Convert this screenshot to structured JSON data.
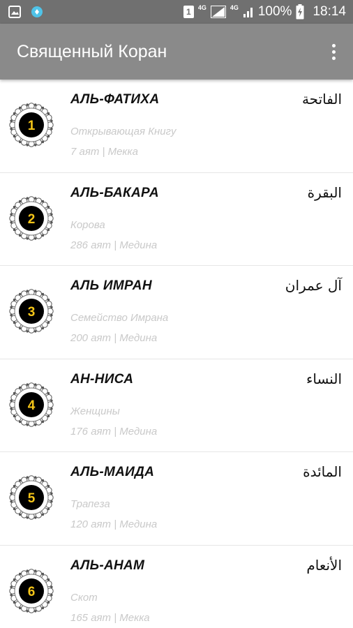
{
  "status_bar": {
    "icons_left": [
      "gallery-icon",
      "app-notification-icon"
    ],
    "sim": "1",
    "network1": "4G",
    "network2": "4G",
    "battery": "100%",
    "time": "18:14"
  },
  "app_bar": {
    "title": "Священный Коран",
    "menu_icon": "more-vert-icon"
  },
  "colors": {
    "status_bar": "#707070",
    "app_bar": "#8a8a8a",
    "badge_fill": "#000000",
    "badge_number": "#f5c518",
    "secondary_text": "#c9c9c9"
  },
  "surahs": [
    {
      "number": "1",
      "name_ru": "АЛЬ-ФАТИХА",
      "name_ar": "الفاتحة",
      "meaning": "Открывающая Книгу",
      "info": "7 аят | Мекка"
    },
    {
      "number": "2",
      "name_ru": "АЛЬ-БАКАРА",
      "name_ar": "البقرة",
      "meaning": "Корова",
      "info": "286 аят | Медина"
    },
    {
      "number": "3",
      "name_ru": "АЛЬ ИМРАН",
      "name_ar": "آل عمران",
      "meaning": "Семейство Имрана",
      "info": "200 аят | Медина"
    },
    {
      "number": "4",
      "name_ru": "АН-НИСА",
      "name_ar": "النساء",
      "meaning": "Женщины",
      "info": "176 аят | Медина"
    },
    {
      "number": "5",
      "name_ru": "АЛЬ-МАИДА",
      "name_ar": "المائدة",
      "meaning": "Трапеза",
      "info": "120 аят | Медина"
    },
    {
      "number": "6",
      "name_ru": "АЛЬ-АНАМ",
      "name_ar": "الأنعام",
      "meaning": "Скот",
      "info": "165 аят | Мекка"
    }
  ]
}
